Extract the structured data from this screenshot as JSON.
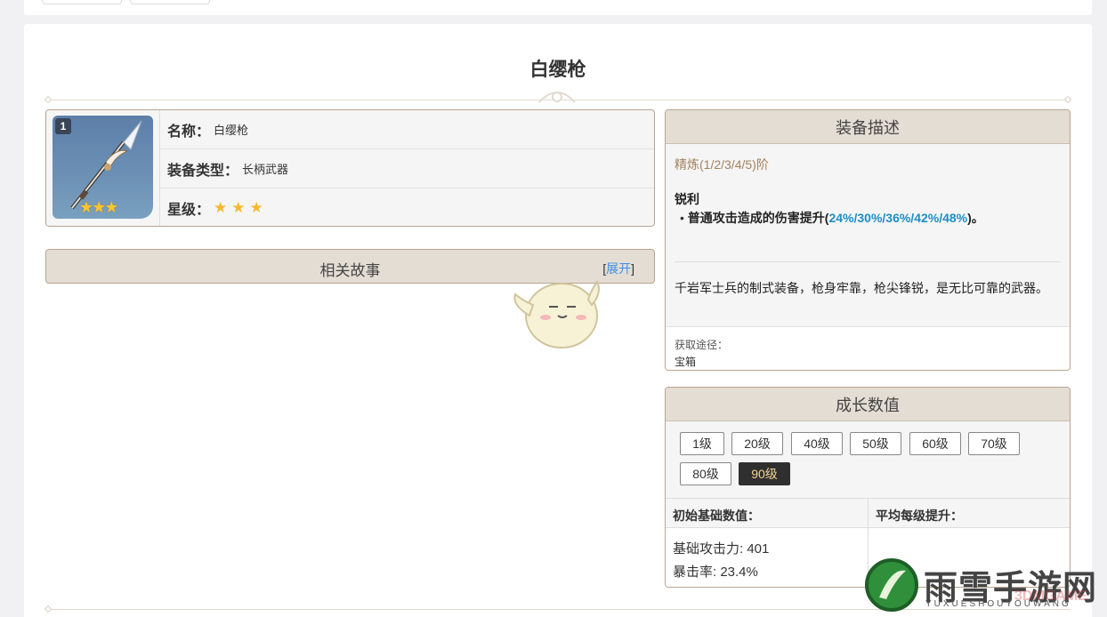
{
  "page": {
    "title": "白缨枪"
  },
  "info": {
    "refine_badge": "1",
    "name_label": "名称：",
    "name_value": "白缨枪",
    "type_label": "装备类型：",
    "type_value": "长柄武器",
    "rarity_label": "星级：",
    "rarity": 3
  },
  "story": {
    "title": "相关故事",
    "expand_open": "[",
    "expand_label": "展开",
    "expand_close": "]"
  },
  "description": {
    "header": "装备描述",
    "refine_line": "精炼(1/2/3/4/5)阶",
    "skill_name": "锐利",
    "skill_text": "普通攻击造成的伤害提升(",
    "skill_values": "24%/30%/36%/42%/48%",
    "skill_tail": ")。",
    "flavor": "千岩军士兵的制式装备，枪身牢靠，枪尖锋锐，是无比可靠的武器。",
    "source_label": "获取途径：",
    "source_value": "宝箱"
  },
  "growth": {
    "header": "成长数值",
    "levels": [
      "1级",
      "20级",
      "40级",
      "50级",
      "60级",
      "70级",
      "80级",
      "90级"
    ],
    "active_level": "90级",
    "col_base": "初始基础数值：",
    "col_avg": "平均每级提升：",
    "stat_atk": "基础攻击力: 401",
    "stat_crit": "暴击率: 23.4%"
  },
  "watermark": {
    "brand": "雨雪手游网",
    "sub": "YUXUESHOUYOUWANG",
    "overlay": "3DMGAME"
  },
  "colors": {
    "accent_blue": "#1d8ec6",
    "border_brown": "#b9a48f",
    "header_beige": "#e4ddd4",
    "star_gold": "#f5b830"
  }
}
